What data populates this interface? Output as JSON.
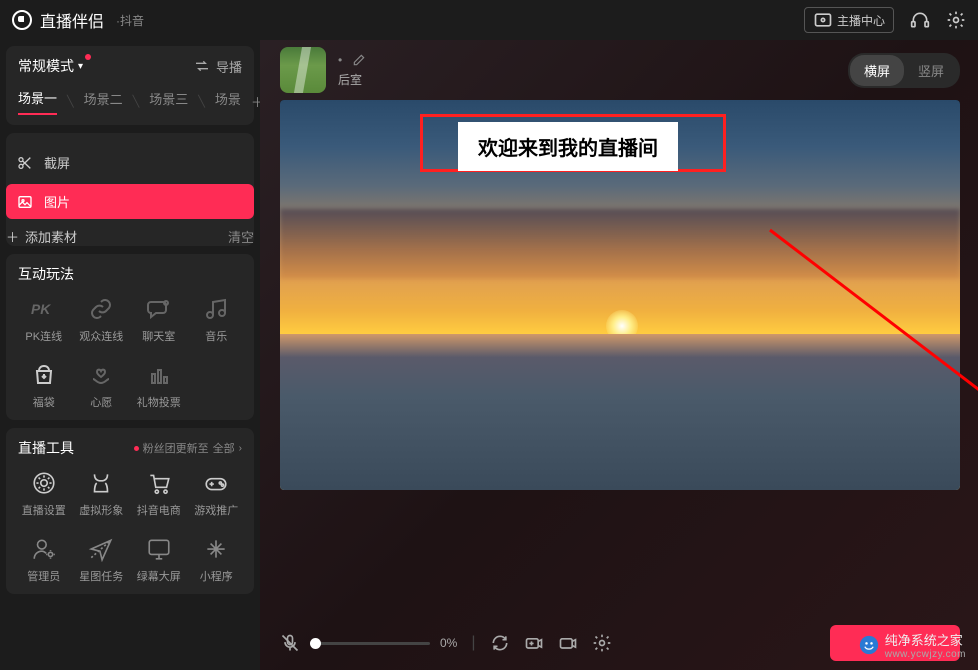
{
  "titlebar": {
    "appName": "直播伴侣",
    "subName": "·抖音",
    "centerBtn": "主播中心"
  },
  "mode": {
    "label": "常规模式",
    "guideLabel": "导播"
  },
  "scenes": {
    "tabs": [
      "场景一",
      "场景二",
      "场景三",
      "场景"
    ],
    "active": 0
  },
  "sources": {
    "items": [
      {
        "label": "截屏",
        "active": false
      },
      {
        "label": "图片",
        "active": true
      }
    ],
    "addLabel": "添加素材",
    "clearLabel": "清空"
  },
  "interact": {
    "title": "互动玩法",
    "items": [
      "PK连线",
      "观众连线",
      "聊天室",
      "音乐",
      "福袋",
      "心愿",
      "礼物投票"
    ]
  },
  "tools": {
    "title": "直播工具",
    "fansUpdate": "粉丝团更新至",
    "allLabel": "全部",
    "items": [
      "直播设置",
      "虚拟形象",
      "抖音电商",
      "游戏推广",
      "管理员",
      "星图任务",
      "绿幕大屏",
      "小程序"
    ]
  },
  "topStrip": {
    "backRoom": "后室",
    "orient": {
      "landscape": "横屏",
      "portrait": "竖屏",
      "active": "landscape"
    }
  },
  "overlay": {
    "text": "欢迎来到我的直播间"
  },
  "bottomBar": {
    "volume": "0%"
  },
  "watermark": {
    "name": "纯净系统之家",
    "url": "www.ycwjzy.com"
  }
}
